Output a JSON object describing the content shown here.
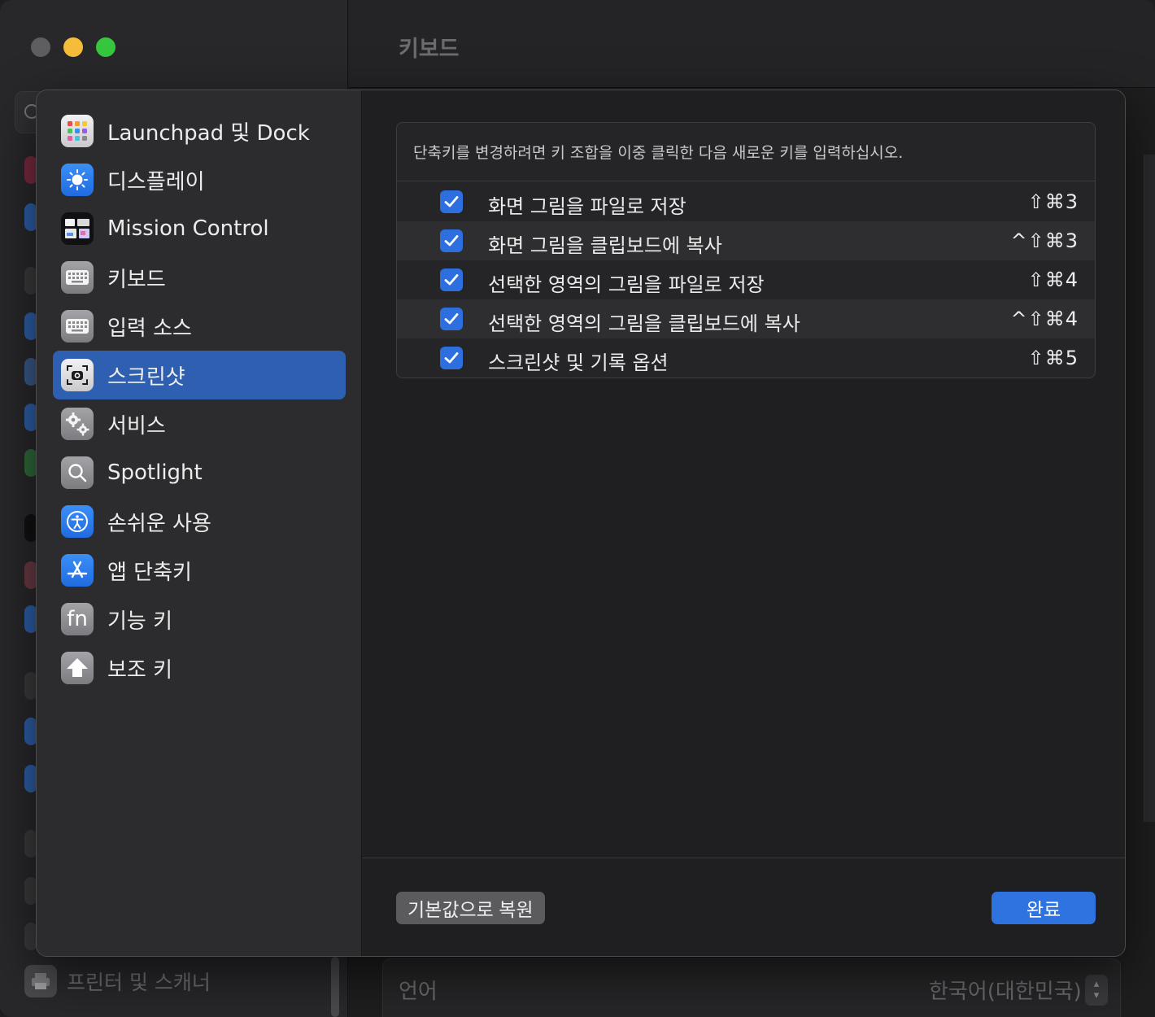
{
  "window": {
    "title": "키보드",
    "traffic_lights": [
      "close",
      "minimize",
      "maximize"
    ]
  },
  "background": {
    "bottom_item": {
      "label": "프린터 및 스캐너",
      "icon": "printer-icon"
    },
    "language_row": {
      "label": "언어",
      "value": "한국어(대한민국)"
    }
  },
  "sheet": {
    "sidebar": {
      "items": [
        {
          "label": "Launchpad 및 Dock",
          "icon": "launchpad-icon",
          "selected": false
        },
        {
          "label": "디스플레이",
          "icon": "display-brightness-icon",
          "selected": false
        },
        {
          "label": "Mission Control",
          "icon": "mission-control-icon",
          "selected": false
        },
        {
          "label": "키보드",
          "icon": "keyboard-icon",
          "selected": false
        },
        {
          "label": "입력 소스",
          "icon": "input-source-icon",
          "selected": false
        },
        {
          "label": "스크린샷",
          "icon": "screenshot-icon",
          "selected": true
        },
        {
          "label": "서비스",
          "icon": "gears-icon",
          "selected": false
        },
        {
          "label": "Spotlight",
          "icon": "spotlight-icon",
          "selected": false
        },
        {
          "label": "손쉬운 사용",
          "icon": "accessibility-icon",
          "selected": false
        },
        {
          "label": "앱 단축키",
          "icon": "app-shortcuts-icon",
          "selected": false
        },
        {
          "label": "기능 키",
          "icon": "fn-key-icon",
          "selected": false
        },
        {
          "label": "보조 키",
          "icon": "modifier-key-icon",
          "selected": false
        }
      ]
    },
    "instruction": "단축키를 변경하려면 키 조합을 이중 클릭한 다음 새로운 키를 입력하십시오.",
    "shortcuts": [
      {
        "label": "화면 그림을 파일로 저장",
        "keys": "⇧⌘3",
        "checked": true
      },
      {
        "label": "화면 그림을 클립보드에 복사",
        "keys": "^⇧⌘3",
        "checked": true
      },
      {
        "label": "선택한 영역의 그림을 파일로 저장",
        "keys": "⇧⌘4",
        "checked": true
      },
      {
        "label": "선택한 영역의 그림을 클립보드에 복사",
        "keys": "^⇧⌘4",
        "checked": true
      },
      {
        "label": "스크린샷 및 기록 옵션",
        "keys": "⇧⌘5",
        "checked": true
      }
    ],
    "buttons": {
      "reset": "기본값으로 복원",
      "done": "완료"
    }
  },
  "colors": {
    "accent": "#2f73e0",
    "selected_item": "#2e5fb0",
    "traffic_close": "#5e5e60",
    "traffic_minimize": "#f5bd3a",
    "traffic_maximize": "#37c73f"
  }
}
